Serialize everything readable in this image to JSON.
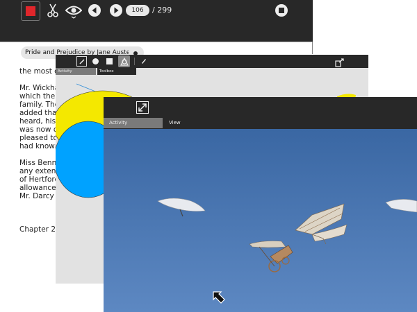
{
  "reader": {
    "page_number": "106",
    "page_total": "/ 299",
    "book_title": "Pride and Prejudice by Jane Austen P",
    "text_lines": [
      "the most c",
      "",
      "Mr. Wickha",
      "which the",
      "family. The",
      "added tha",
      "heard, his",
      "was now o",
      "pleased to",
      "had known",
      "",
      "Miss Benne",
      "any extent",
      "of Hertford",
      "allowance",
      "Mr. Darcy",
      "",
      "",
      "",
      "Chapter 2"
    ]
  },
  "paint": {
    "tabs": [
      "Activity",
      "Toolbox"
    ]
  },
  "photo": {
    "tabs": [
      "Activity",
      "View"
    ]
  },
  "colors": {
    "toolbar": "#282828",
    "sky": "#3f6fa8",
    "paint_yellow": "#f4e800",
    "paint_blue": "#00a2ff",
    "stop_red": "#e0262b"
  }
}
